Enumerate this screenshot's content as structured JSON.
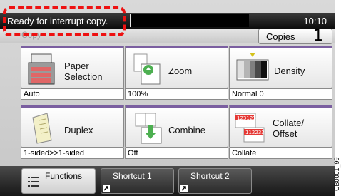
{
  "status": {
    "message": "Ready for interrupt copy.",
    "time": "10:10"
  },
  "subbar": {
    "label": "Copy"
  },
  "copies": {
    "label": "Copies",
    "value": "1"
  },
  "tiles": [
    {
      "label": "Paper\nSelection",
      "value": "Auto",
      "icon": "printer-paper-icon"
    },
    {
      "label": "Zoom",
      "value": "100%",
      "icon": "zoom-icon"
    },
    {
      "label": "Density",
      "value": "Normal 0",
      "icon": "density-icon"
    },
    {
      "label": "Duplex",
      "value": "1-sided>>1-sided",
      "icon": "duplex-icon"
    },
    {
      "label": "Combine",
      "value": "Off",
      "icon": "combine-icon"
    },
    {
      "label": "Collate/\nOffset",
      "value": "Collate",
      "icon": "collate-icon"
    }
  ],
  "tabs": [
    {
      "label": "Functions",
      "icon": "menu-list-icon"
    },
    {
      "label": "Shortcut 1",
      "icon": "shortcut-arrow-icon"
    },
    {
      "label": "Shortcut 2",
      "icon": "shortcut-arrow-icon"
    }
  ],
  "side_code": "CB0001_99",
  "colors": {
    "accent": "#7b5fa0",
    "callout": "#e11111"
  }
}
